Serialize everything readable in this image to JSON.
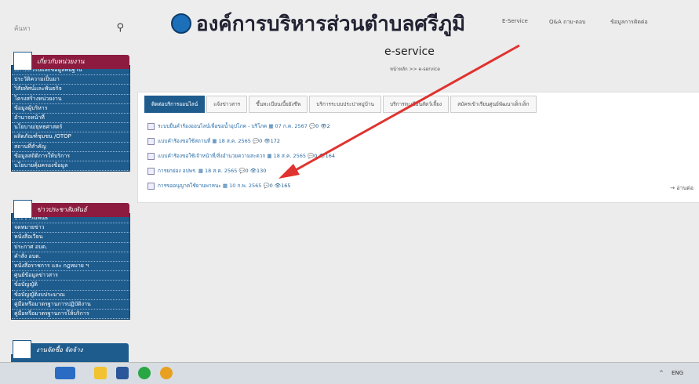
{
  "header": {
    "search_placeholder": "ค้นหา",
    "site_title": "องค์การบริหารส่วนตำบลศรีภูมิ",
    "nav": [
      "E-Service",
      "Q&A ถาม-ตอบ",
      "ข้อมูลการติดต่อ"
    ]
  },
  "sidebar": {
    "section1": {
      "title": "เกี่ยวกับหน่วยงาน",
      "items": [
        "สภาพทั่วไปและข้อมูลพื้นฐาน",
        "ประวัติความเป็นมา",
        "วิสัยทัศน์และพันธกิจ",
        "โครงสร้างหน่วยงาน",
        "ข้อมูลผู้บริหาร",
        "อำนาจหน้าที่",
        "นโยบาย/ยุทธศาสตร์",
        "ผลิตภัณฑ์ชุมชน /OTOP",
        "สถานที่สำคัญ",
        "ข้อมูลสถิติการให้บริการ",
        "นโยบายคุ้มครองข้อมูล"
      ]
    },
    "section2": {
      "title": "ข่าวประชาสัมพันธ์",
      "items": [
        "ประชาสัมพันธ์",
        "จดหมายข่าว",
        "หนังสือเวียน",
        "ประกาศ อบต.",
        "คำสั่ง อบต.",
        "หนังสือราชการ และ กฎหมาย ฯ",
        "ศูนย์ข้อมูลข่าวสาร",
        "ข้อบัญญัติ",
        "ข้อบัญญัติงบประมาณ",
        "คู่มือหรือมาตรฐานการปฏิบัติงาน",
        "คู่มือหรือมาตรฐานการให้บริการ"
      ]
    },
    "section3": {
      "title": "งานจัดซื้อ จัดจ้าง"
    }
  },
  "main": {
    "title": "e-service",
    "breadcrumb": "หน้าหลัก >> e-service",
    "tabs": [
      "ติดต่อบริการออนไลน์",
      "แจ้งข่าวสาร",
      "ขึ้นทะเบียนเบี้ยยังชีพ",
      "บริการระบบประปาหมู่บ้าน",
      "บริการทะเบียนสัตว์เลี้ยง",
      "สมัครเข้าเรียนศูนย์พัฒนาเด็กเล็ก"
    ],
    "rows": [
      {
        "text": "ระบบยื่นคำร้องออนไลน์เพื่อขอน้ำอุปโภค - บริโภค",
        "date": "07 ก.ค. 2567",
        "comments": "0",
        "views": "2"
      },
      {
        "text": "แบบคำร้องขอใช้สถานที่",
        "date": "18 ส.ค. 2565",
        "comments": "0",
        "views": "172"
      },
      {
        "text": "แบบคำร้องขอใช้เจ้าหน้าที่/สิ่งอำนวยความสะดวก",
        "date": "18 ส.ค. 2565",
        "comments": "0",
        "views": "164"
      },
      {
        "text": "การยกย่อง อปพร.",
        "date": "18 ส.ค. 2565",
        "comments": "0",
        "views": "130"
      },
      {
        "text": "การขออนุญาตใช้ยานพาหนะ",
        "date": "10 ก.พ. 2565",
        "comments": "0",
        "views": "165"
      }
    ],
    "more": "→ อ่านต่อ"
  },
  "taskbar": {
    "lang": "ENG"
  },
  "colors": {
    "sidebar_bg": "#1f5c8e",
    "caption_bg": "#8c1b3f",
    "arrow": "#e0332f"
  }
}
